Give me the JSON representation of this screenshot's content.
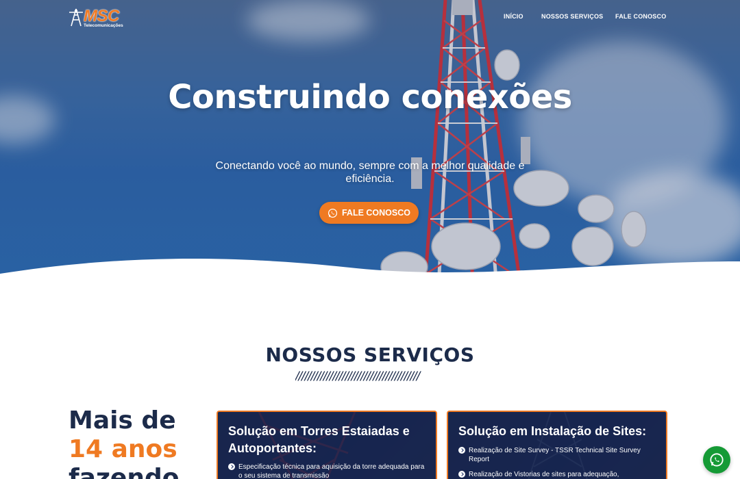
{
  "brand": {
    "name": "MSC",
    "tagline": "Telecomunicações",
    "accent": "#ef7a22",
    "navy": "#1c2b4a"
  },
  "nav": {
    "items": [
      {
        "label": "INÍCIO"
      },
      {
        "label": "NOSSOS SERVIÇOS"
      },
      {
        "label": "FALE CONOSCO"
      }
    ]
  },
  "hero": {
    "title": "Construindo conexões",
    "subtitle": "Conectando você ao mundo, sempre com a melhor qualidade e eficiência.",
    "cta_label": "FALE CONOSCO",
    "cta_icon": "whatsapp-icon"
  },
  "services": {
    "title": "NOSSOS SERVIÇOS",
    "divider": "////////////////////////////////////////",
    "experience": {
      "prefix": "Mais de",
      "highlight": "14 anos",
      "suffix": "fazendo"
    },
    "cards": [
      {
        "title": "Solução em Torres Estaiadas e Autoportantes:",
        "items": [
          "Especificação técnica para aquisição da torre adequada para o seu sistema de transmissão"
        ]
      },
      {
        "title": "Solução em Instalação de Sites:",
        "items": [
          "Realização de Site Survey - TSSR Technical Site Survey Report",
          "Realização de Vistorias de sites para adequação,"
        ]
      }
    ]
  },
  "floating": {
    "whatsapp_icon": "whatsapp-icon",
    "color": "#159a35"
  }
}
